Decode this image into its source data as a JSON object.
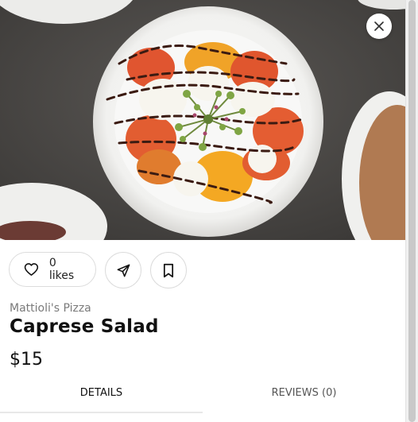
{
  "item": {
    "restaurant": "Mattioli's Pizza",
    "title": "Caprese Salad",
    "price": "$15"
  },
  "actions": {
    "likes_label": "0 likes"
  },
  "tabs": {
    "details": "DETAILS",
    "reviews": "REVIEWS (0)"
  },
  "icons": {
    "close": "close-icon",
    "like": "heart-icon",
    "share": "send-icon",
    "save": "bookmark-icon"
  }
}
